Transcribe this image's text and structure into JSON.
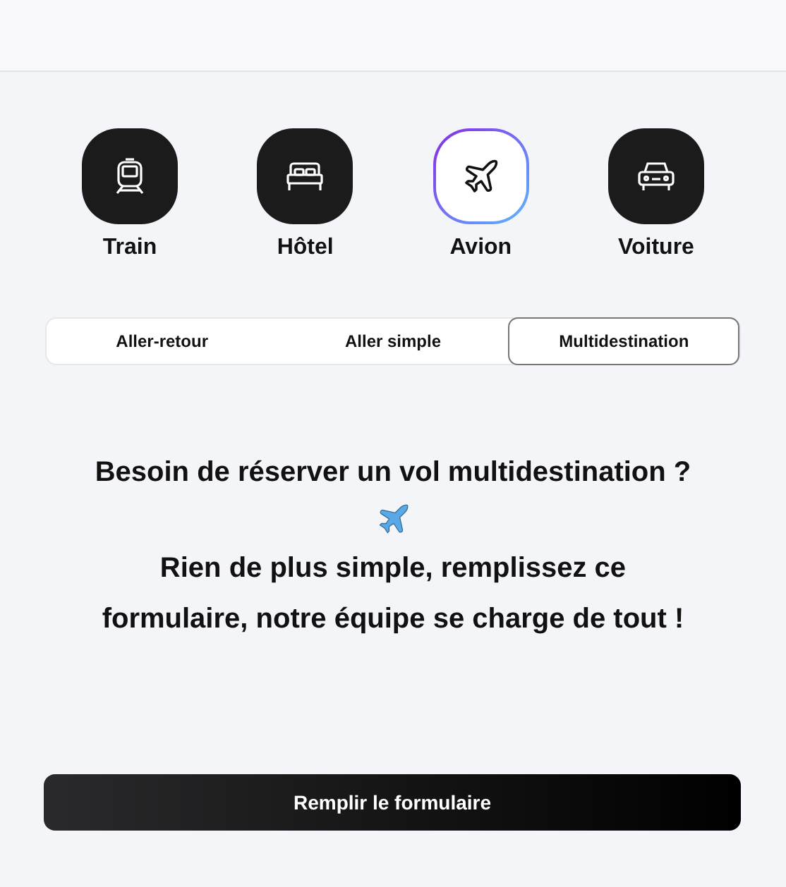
{
  "categories": [
    {
      "kind": "train",
      "label": "Train",
      "selected": false
    },
    {
      "kind": "hotel",
      "label": "Hôtel",
      "selected": false
    },
    {
      "kind": "plane",
      "label": "Avion",
      "selected": true
    },
    {
      "kind": "car",
      "label": "Voiture",
      "selected": false
    }
  ],
  "trip_tabs": [
    {
      "label": "Aller-retour",
      "selected": false
    },
    {
      "label": "Aller simple",
      "selected": false
    },
    {
      "label": "Multidestination",
      "selected": true
    }
  ],
  "message": {
    "line_1": "Besoin de réserver un vol multidestination ?",
    "line_2": "Rien de plus simple, remplissez ce formulaire, notre équipe se charge de tout !"
  },
  "button": {
    "label": "Remplir le formulaire"
  }
}
